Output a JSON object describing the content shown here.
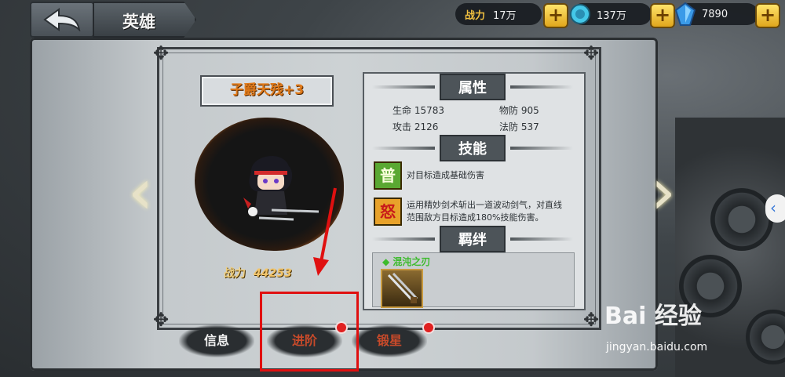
{
  "header": {
    "title": "英雄",
    "back_icon": "back-arrow-icon"
  },
  "resources": [
    {
      "label": "战力",
      "value": "17万",
      "icon": ""
    },
    {
      "label": "",
      "value": "137万",
      "icon": "coin-icon"
    },
    {
      "label": "",
      "value": "7890",
      "icon": "gem-icon"
    }
  ],
  "plus_label": "+",
  "hero": {
    "name": "子爵天残+3",
    "power_label": "战力",
    "power_value": "44253"
  },
  "attributes": {
    "heading": "属性",
    "stats": [
      {
        "label": "生命",
        "value": "15783"
      },
      {
        "label": "物防",
        "value": "905"
      },
      {
        "label": "攻击",
        "value": "2126"
      },
      {
        "label": "法防",
        "value": "537"
      }
    ]
  },
  "skills": {
    "heading": "技能",
    "items": [
      {
        "badge": "普",
        "desc": "对目标造成基础伤害",
        "color": "#5aa832"
      },
      {
        "badge": "怒",
        "desc_line1": "运用精妙剑术斩出一道波动剑气，对直线",
        "desc_line2": "范围敌方目标造成180%技能伤害。",
        "color": "#e8a22a"
      }
    ]
  },
  "fetters": {
    "heading": "羁绊",
    "name": "混沌之刃"
  },
  "tabs": [
    {
      "label": "信息",
      "dot": false
    },
    {
      "label": "进阶",
      "dot": true
    },
    {
      "label": "锻星",
      "dot": true
    }
  ],
  "watermark": {
    "logo_text": "Bai 经验",
    "url": "jingyan.baidu.com"
  },
  "colors": {
    "accent_gold": "#f0c040",
    "highlight_red": "#e01010",
    "notification_red": "#e02020"
  }
}
